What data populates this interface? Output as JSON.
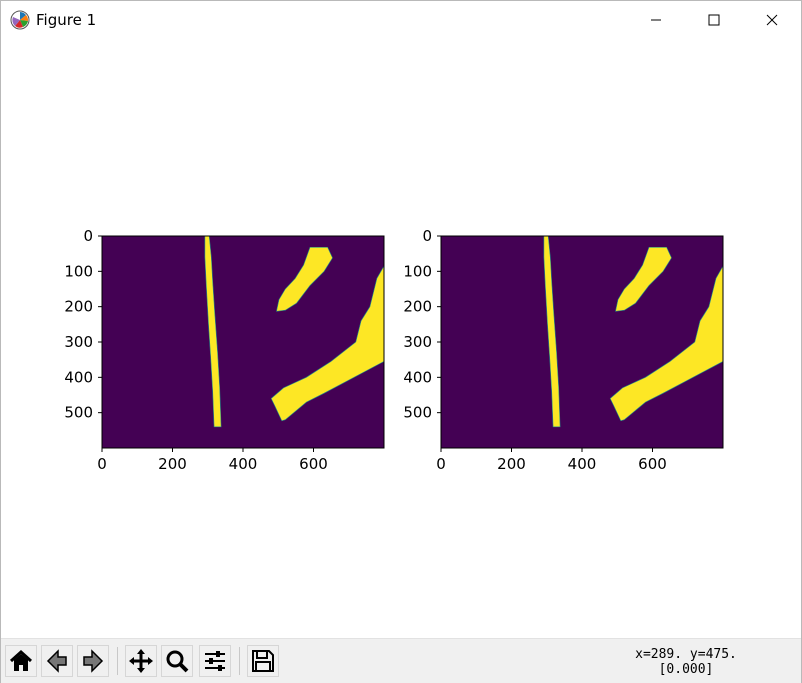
{
  "window": {
    "title": "Figure 1",
    "icon": "matplotlib-logo-icon"
  },
  "figure": {
    "colors": {
      "background": "#440154",
      "foreground": "#fde725",
      "edge": "#21918c"
    },
    "panels": [
      {
        "name": "left-image-axes",
        "x_ticks": [
          "0",
          "200",
          "400",
          "600"
        ],
        "y_ticks": [
          "0",
          "100",
          "200",
          "300",
          "400",
          "500"
        ]
      },
      {
        "name": "right-image-axes",
        "x_ticks": [
          "0",
          "200",
          "400",
          "600"
        ],
        "y_ticks": [
          "0",
          "100",
          "200",
          "300",
          "400",
          "500"
        ]
      }
    ]
  },
  "chart_data": [
    {
      "type": "heatmap",
      "title": "",
      "xlabel": "",
      "ylabel": "",
      "xlim": [
        0,
        800
      ],
      "ylim": [
        600,
        0
      ],
      "xticks": [
        0,
        200,
        400,
        600
      ],
      "yticks": [
        0,
        100,
        200,
        300,
        400,
        500
      ],
      "colormap": "viridis",
      "values": "binary mask (0 = background, 1 = lane markings)"
    },
    {
      "type": "heatmap",
      "title": "",
      "xlabel": "",
      "ylabel": "",
      "xlim": [
        0,
        800
      ],
      "ylim": [
        600,
        0
      ],
      "xticks": [
        0,
        200,
        400,
        600
      ],
      "yticks": [
        0,
        100,
        200,
        300,
        400,
        500
      ],
      "colormap": "viridis",
      "values": "binary mask (0 = background, 1 = lane markings)"
    }
  ],
  "toolbar": {
    "buttons": [
      {
        "name": "home-button",
        "icon": "home-icon"
      },
      {
        "name": "back-button",
        "icon": "back-arrow-icon"
      },
      {
        "name": "forward-button",
        "icon": "forward-arrow-icon"
      },
      {
        "name": "pan-button",
        "icon": "move-icon"
      },
      {
        "name": "zoom-button",
        "icon": "magnifier-icon"
      },
      {
        "name": "configure-subplots-button",
        "icon": "sliders-icon"
      },
      {
        "name": "save-button",
        "icon": "floppy-disk-icon"
      }
    ],
    "coords_line1": "x=289.  y=475.",
    "coords_line2": "[0.000]"
  }
}
